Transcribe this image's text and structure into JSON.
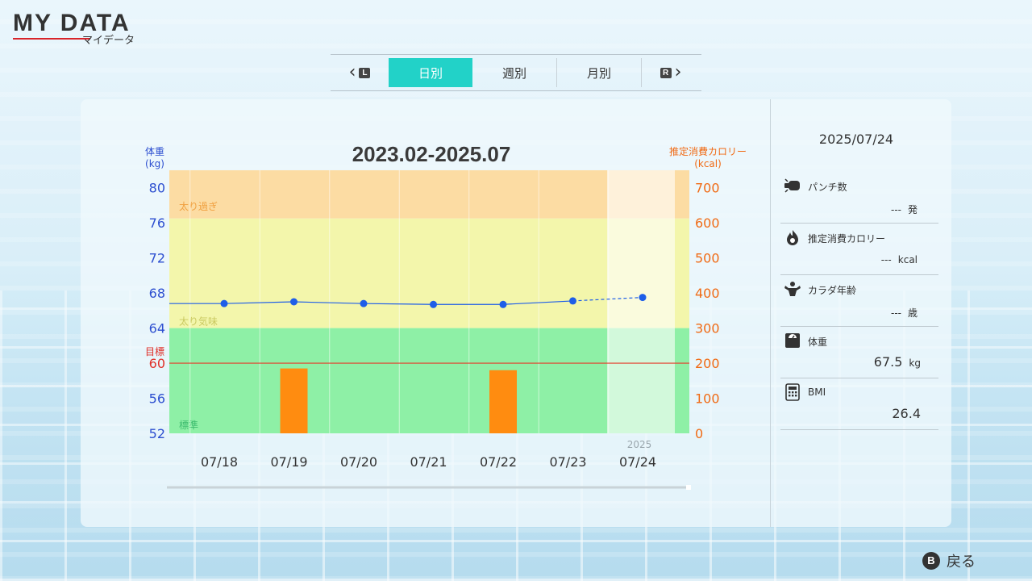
{
  "screen": {
    "title": "MY DATA",
    "subtitle": "マイデータ"
  },
  "tabs": {
    "left_button": "L",
    "right_button": "R",
    "items": [
      {
        "label": "日別",
        "active": true
      },
      {
        "label": "週別",
        "active": false
      },
      {
        "label": "月別",
        "active": false
      }
    ]
  },
  "chart_data": {
    "type": "bar+line",
    "title": "2023.02-2025.07",
    "y_left_label": "体重",
    "y_left_unit": "(kg)",
    "y_right_label": "推定消費カロリー",
    "y_right_unit": "(kcal)",
    "y_left_ticks": [
      80,
      76,
      72,
      68,
      64,
      60,
      56,
      52
    ],
    "y_right_ticks": [
      700,
      600,
      500,
      400,
      300,
      200,
      100,
      0
    ],
    "ylim_left": [
      52,
      82
    ],
    "ylim_right": [
      0,
      750
    ],
    "target_label": "目標",
    "target_value": 60,
    "zones": [
      {
        "label": "太り過ぎ",
        "from": 76.5,
        "to": 82,
        "color": "#fcdca3"
      },
      {
        "label": "太り気味",
        "from": 64,
        "to": 76.5,
        "color": "#f3f6ab"
      },
      {
        "label": "標準",
        "from": 52,
        "to": 64,
        "color": "#8ef0a6"
      }
    ],
    "categories": [
      "07/18",
      "07/19",
      "07/20",
      "07/21",
      "07/22",
      "07/23",
      "07/24"
    ],
    "year_label": "2025",
    "highlight_category": "07/24",
    "series": [
      {
        "type": "line",
        "axis": "left",
        "color": "#1e5ee8",
        "values": [
          66.8,
          67.0,
          66.8,
          66.7,
          66.7,
          67.1,
          67.5
        ]
      },
      {
        "type": "bar",
        "axis": "right",
        "color": "#ff8c10",
        "values": [
          0,
          185,
          0,
          0,
          180,
          0,
          0
        ]
      }
    ]
  },
  "info_panel": {
    "date": "2025/07/24",
    "items": [
      {
        "icon": "punch-icon",
        "label": "パンチ数",
        "value": "---",
        "unit": "発"
      },
      {
        "icon": "flame-icon",
        "label": "推定消費カロリー",
        "value": "---",
        "unit": "kcal"
      },
      {
        "icon": "muscle-icon",
        "label": "カラダ年齢",
        "value": "---",
        "unit": "歳"
      },
      {
        "icon": "scale-icon",
        "label": "体重",
        "value": "67.5",
        "unit": "kg"
      },
      {
        "icon": "calculator-icon",
        "label": "BMI",
        "value": "26.4",
        "unit": ""
      }
    ]
  },
  "footer": {
    "back_button": "B",
    "back_label": "戻る"
  }
}
